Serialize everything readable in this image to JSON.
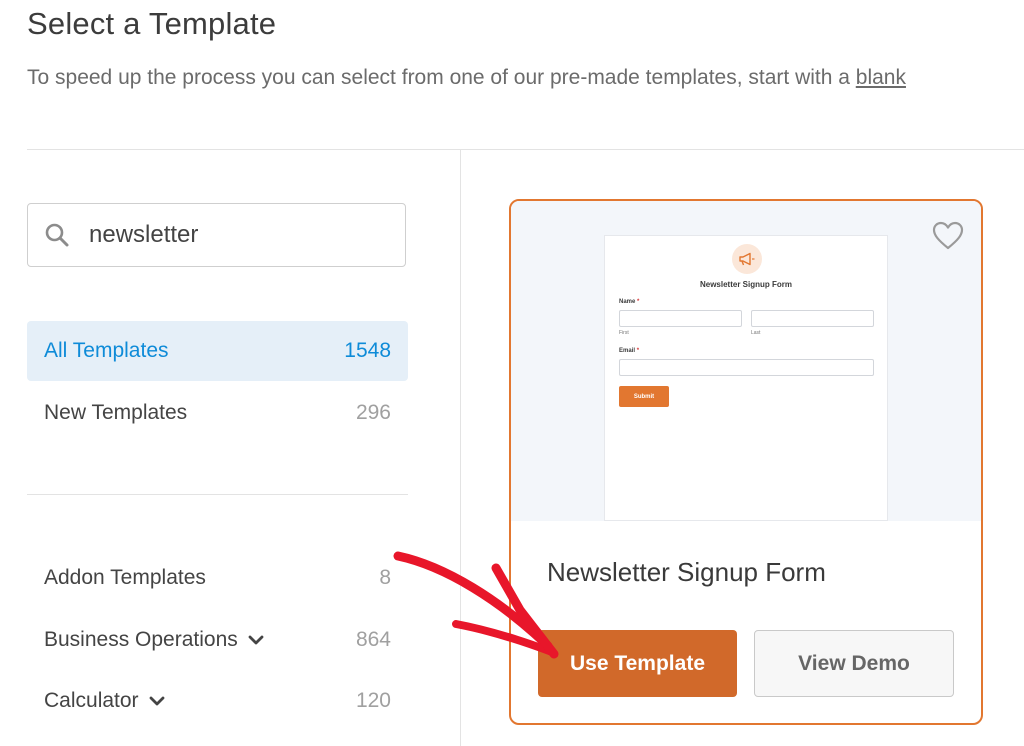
{
  "header": {
    "title": "Select a Template",
    "intro_text": "To speed up the process you can select from one of our pre-made templates, start with a ",
    "intro_link": "blank"
  },
  "search": {
    "value": "newsletter",
    "icon": "search-icon"
  },
  "categories": [
    {
      "label": "All Templates",
      "count": "1548",
      "active": true
    },
    {
      "label": "New Templates",
      "count": "296"
    },
    {
      "label": "Addon Templates",
      "count": "8"
    },
    {
      "label": "Business Operations",
      "count": "864",
      "expandable": true
    },
    {
      "label": "Calculator",
      "count": "120",
      "expandable": true
    }
  ],
  "template_card": {
    "title": "Newsletter Signup Form",
    "favorite_icon": "heart-icon",
    "use_button": "Use Template",
    "demo_button": "View Demo",
    "preview": {
      "icon": "megaphone-icon",
      "form_title": "Newsletter Signup Form",
      "name_label": "Name",
      "required_mark": "*",
      "first_sublabel": "First",
      "last_sublabel": "Last",
      "email_label": "Email",
      "submit_label": "Submit"
    }
  },
  "colors": {
    "accent": "#e27730",
    "use_button": "#d1692a",
    "active_category_bg": "#e5eff8",
    "active_category_text": "#0e8bd8",
    "annotation_arrow": "#e8162a"
  }
}
